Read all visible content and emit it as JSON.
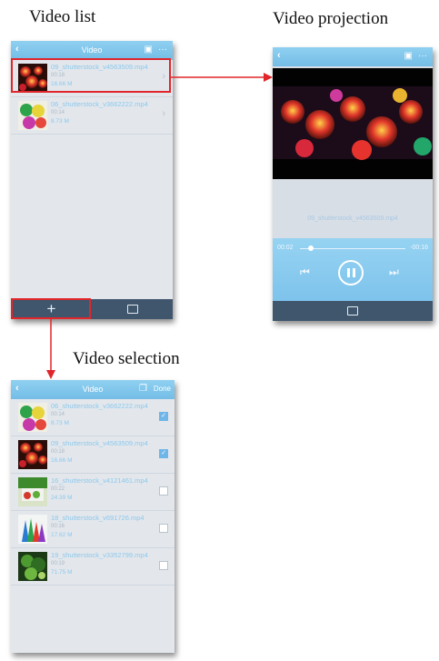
{
  "captions": {
    "list": "Video list",
    "projection": "Video projection",
    "selection": "Video selection"
  },
  "list_screen": {
    "title": "Video",
    "items": [
      {
        "name": "09_shutterstock_v4563509.mp4",
        "time": "00:18",
        "size": "16.66 M"
      },
      {
        "name": "06_shutterstock_v3662222.mp4",
        "time": "00:14",
        "size": "8.73 M"
      }
    ],
    "add_label": "+"
  },
  "projection_screen": {
    "filename": "09_shutterstock_v4563509.mp4",
    "elapsed": "00:02",
    "remaining": "-00:16",
    "progress": 0.11
  },
  "selection_screen": {
    "title": "Video",
    "done_label": "Done",
    "items": [
      {
        "name": "06_shutterstock_v3662222.mp4",
        "time": "00:14",
        "size": "8.73 M",
        "checked": true
      },
      {
        "name": "09_shutterstock_v4563509.mp4",
        "time": "00:18",
        "size": "16.66 M",
        "checked": true
      },
      {
        "name": "16_shutterstock_v4121461.mp4",
        "time": "00:22",
        "size": "24.39 M",
        "checked": false
      },
      {
        "name": "18_shutterstock_v691726.mp4",
        "time": "00:16",
        "size": "17.62 M",
        "checked": false
      },
      {
        "name": "19_shutterstock_v3352799.mp4",
        "time": "00:19",
        "size": "71.75 M",
        "checked": false
      }
    ]
  },
  "colors": {
    "highlight": "#e0262b",
    "nav": "#7fc5ea",
    "bottombar": "#3f566d",
    "player": "#8fcdf0"
  }
}
